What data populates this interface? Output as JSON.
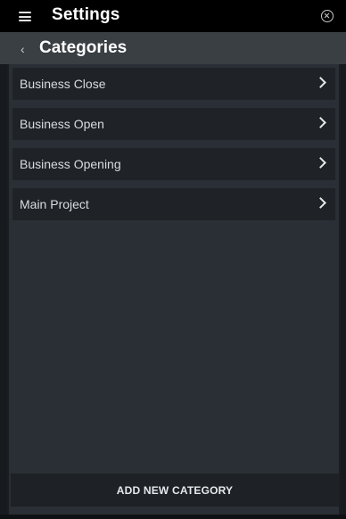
{
  "header": {
    "title": "Settings",
    "menu_icon": "hamburger-menu-icon",
    "close_icon": "close-circle-icon"
  },
  "subheader": {
    "back_icon": "chevron-left-icon",
    "back_glyph": "‹",
    "title": "Categories"
  },
  "categories": [
    {
      "label": "Business Close",
      "icon": "chevron-right-icon"
    },
    {
      "label": "Business Open",
      "icon": "chevron-right-icon"
    },
    {
      "label": "Business Opening",
      "icon": "chevron-right-icon"
    },
    {
      "label": "Main Project",
      "icon": "chevron-right-icon"
    }
  ],
  "actions": {
    "add_label": "ADD NEW CATEGORY"
  },
  "colors": {
    "topbar": "#000000",
    "subheader": "#3a3f44",
    "panel": "#2a2f35",
    "list_item": "#1f2327",
    "text": "#d9dcdf"
  }
}
